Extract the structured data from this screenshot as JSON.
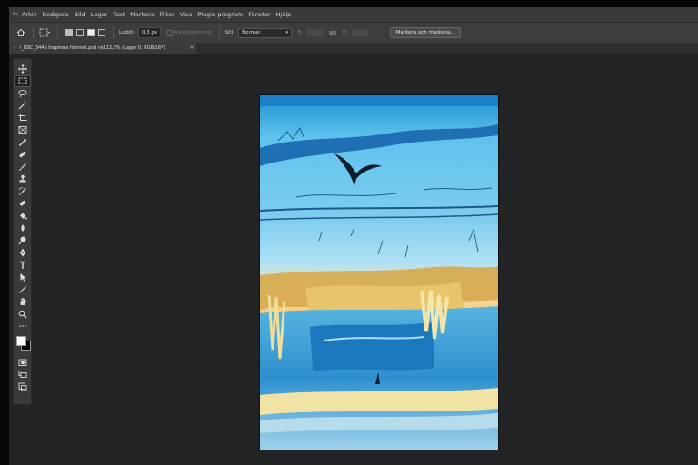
{
  "menubar": {
    "logo": "Ps",
    "items": [
      "Arkiv",
      "Redigera",
      "Bild",
      "Lager",
      "Text",
      "Markera",
      "Filter",
      "Visa",
      "Plugin-program",
      "Fönster",
      "Hjälp"
    ]
  },
  "options": {
    "feather_label": "Luddi:",
    "feather_value": "0,3 px",
    "antialias_label": "Kantutjämning",
    "style_label": "Stil:",
    "style_value": "Normal",
    "width_label": "B:",
    "height_label": "H:",
    "select_mask_button": "Markera och maskera..."
  },
  "document_tab": {
    "title": "l_DSC_3445 Inspirera himmel.psd vid 12,5% (Lager 0, RGB/16*)"
  },
  "tools": [
    "move-tool-icon",
    "marquee-tool-icon",
    "lasso-tool-icon",
    "magic-wand-tool-icon",
    "crop-tool-icon",
    "frame-tool-icon",
    "eyedropper-tool-icon",
    "healing-brush-tool-icon",
    "brush-tool-icon",
    "clone-stamp-tool-icon",
    "history-brush-tool-icon",
    "eraser-tool-icon",
    "paint-bucket-tool-icon",
    "blur-tool-icon",
    "dodge-tool-icon",
    "pen-tool-icon",
    "type-tool-icon",
    "path-selection-tool-icon",
    "line-tool-icon",
    "hand-tool-icon",
    "zoom-tool-icon",
    "more-tools-icon"
  ],
  "colors": {
    "foreground": "#ffffff",
    "background": "#000000",
    "workspace": "#222325"
  }
}
